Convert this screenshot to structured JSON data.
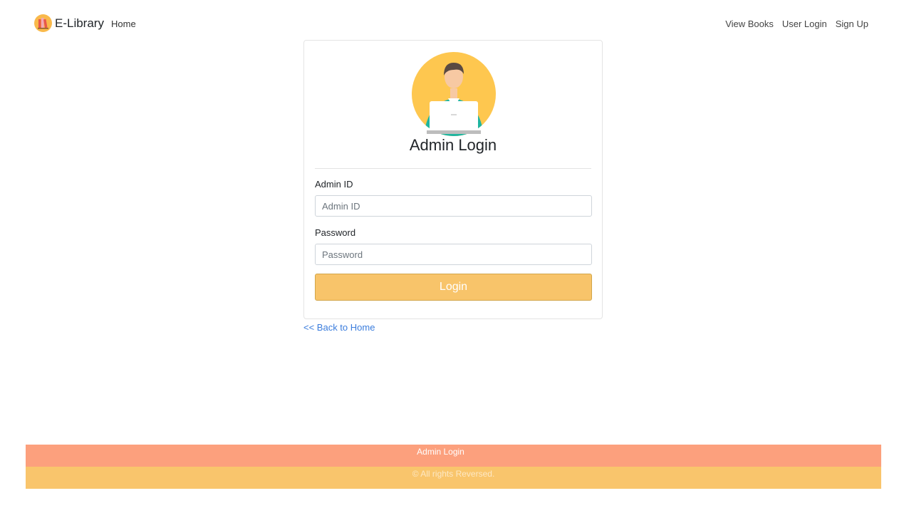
{
  "navbar": {
    "brand": "E-Library",
    "brand_logo_icon": "books-logo-icon",
    "home": "Home",
    "links": [
      "View Books",
      "User Login",
      "Sign Up"
    ]
  },
  "login_card": {
    "avatar_icon": "admin-user-laptop-icon",
    "title": "Admin Login",
    "admin_id_label": "Admin ID",
    "admin_id_placeholder": "Admin ID",
    "admin_id_value": "",
    "password_label": "Password",
    "password_placeholder": "Password",
    "password_value": "",
    "login_button": "Login"
  },
  "back_link": "<< Back to Home",
  "footer": {
    "page_name": "Admin Login",
    "copyright": "© All rights Reversed."
  },
  "colors": {
    "accent": "#f8c46a",
    "footer_top": "#fca07d",
    "footer_bottom": "#f9c56c",
    "link": "#3b7ddd"
  }
}
